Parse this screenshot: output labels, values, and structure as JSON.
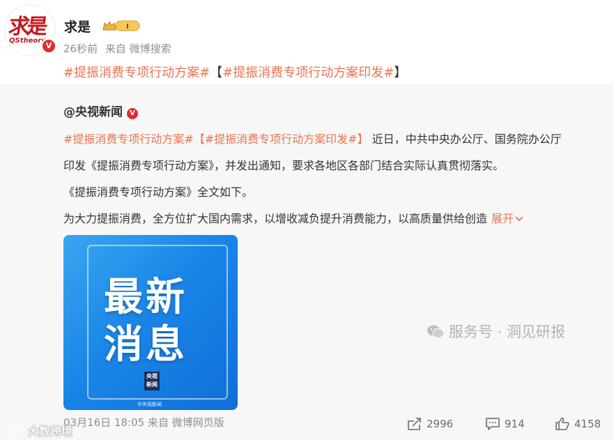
{
  "post": {
    "author": "求是",
    "level": "I",
    "time": "26秒前",
    "source": "来自 微博搜索",
    "tag1": "#提振消费专项行动方案#",
    "bracket_open": "【",
    "tag2": "#提振消费专项行动方案印发#",
    "bracket_close": "】"
  },
  "avatar": {
    "calligraphy": "求是",
    "sub_text": "QStheory",
    "verified_glyph": "V"
  },
  "repost": {
    "author": "@央视新闻",
    "line1_tag1": "#提振消费专项行动方案#",
    "line1_tag2": "【#提振消费专项行动方案印发#】",
    "line1_text": " 近日，中共中央办公厅、国务院办公厅",
    "line2": "印发《提振消费专项行动方案》，并发出通知，要求各地区各部门结合实际认真贯彻落实。",
    "line3": "《提振消费专项行动方案》全文如下。",
    "line4": "为大力提振消费，全方位扩大国内需求，以增收减负提升消费能力，以高质量供给创造",
    "expand": "展开",
    "image_title_1": "最新",
    "image_title_2": "消息",
    "image_logo": "央视新闻",
    "image_watermark": "中央视新闻",
    "date": "03月16日 18:05",
    "source": "来自 微博网页版"
  },
  "actions": {
    "reposts": "2996",
    "comments": "914",
    "likes": "4158"
  },
  "watermarks": {
    "wechat": "服务号 · 洞见研报",
    "weibo": "大数跨境"
  },
  "colors": {
    "accent": "#eb7350",
    "verified": "#e02d2d",
    "repost_bg": "#f7f7f7",
    "image_blue": "#1a86e8"
  }
}
